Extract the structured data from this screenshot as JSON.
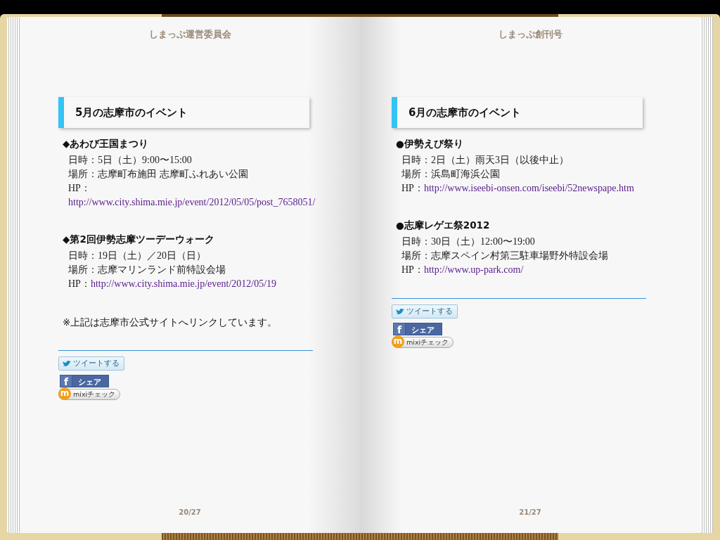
{
  "pages": [
    {
      "header": "しまっぷ運営委員会",
      "heading": "5月の志摩市のイベント",
      "events": [
        {
          "title": "◆あわび王国まつり",
          "lines": [
            "日時：5日（土）9:00〜15:00",
            "場所：志摩町布施田 志摩町ふれあい公園"
          ],
          "hp_label": "HP：",
          "link": "http://www.city.shima.mie.jp/event/2012/05/05/post_7658051/"
        },
        {
          "title": "◆第2回伊勢志摩ツーデーウォーク",
          "lines": [
            "日時：19日（土）／20日（日）",
            "場所：志摩マリンランド前特設会場"
          ],
          "hp_label": "HP：",
          "link": "http://www.city.shima.mie.jp/event/2012/05/19"
        }
      ],
      "note": "※上記は志摩市公式サイトへリンクしています。",
      "share": [
        {
          "kind": "tweet",
          "label": "ツイートする"
        },
        {
          "kind": "facebook",
          "icon": "f",
          "label": "シェア"
        },
        {
          "kind": "mixi",
          "icon": "m",
          "label": "mixiチェック"
        }
      ],
      "page_number": "20/27"
    },
    {
      "header": "しまっぷ創刊号",
      "heading": "6月の志摩市のイベント",
      "events": [
        {
          "title": "●伊勢えび祭り",
          "lines": [
            "日時：2日（土）雨天3日（以後中止）",
            "場所：浜島町海浜公園"
          ],
          "hp_label": "HP：",
          "link": "http://www.iseebi-onsen.com/iseebi/52newspape.htm"
        },
        {
          "title": "●志摩レゲエ祭2012",
          "lines": [
            "日時：30日（土）12:00〜19:00",
            "場所：志摩スペイン村第三駐車場野外特設会場"
          ],
          "hp_label": "HP：",
          "link": "http://www.up-park.com/"
        }
      ],
      "share": [
        {
          "kind": "tweet",
          "label": "ツイートする"
        },
        {
          "kind": "facebook",
          "icon": "f",
          "label": "シェア"
        },
        {
          "kind": "mixi",
          "icon": "m",
          "label": "mixiチェック"
        }
      ],
      "page_number": "21/27"
    }
  ]
}
